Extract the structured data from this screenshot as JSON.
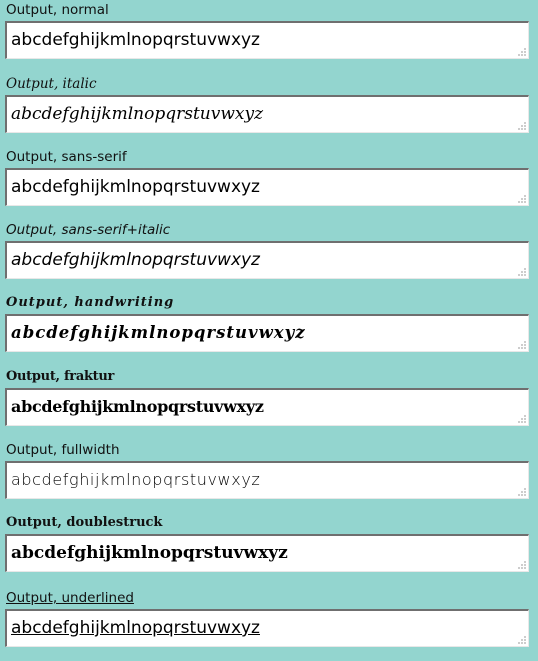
{
  "fields": [
    {
      "label": "Output, normal",
      "value": "abcdefghijkmlnopqrstuvwxyz"
    },
    {
      "label": "Output, italic",
      "value": "abcdefghijkmlnopqrstuvwxyz"
    },
    {
      "label": "Output, sans-serif",
      "value": "abcdefghijkmlnopqrstuvwxyz"
    },
    {
      "label": "Output, sans-serif+italic",
      "value": "abcdefghijkmlnopqrstuvwxyz"
    },
    {
      "label": "Output, handwriting",
      "value": "abcdefghijkmlnopqrstuvwxyz"
    },
    {
      "label": "Output, fraktur",
      "value": "abcdefghijkmlnopqrstuvwxyz"
    },
    {
      "label": "Output, fullwidth",
      "value": "abcdefghijkmlnopqrstuvwxyz"
    },
    {
      "label": "Output, doublestruck",
      "value": "abcdefghijkmlnopqrstuvwxyz"
    },
    {
      "label": "Output, underlined",
      "value": "abcdefghijkmlnopqrstuvwxyz"
    }
  ],
  "icons": {
    "resize": "resize-grip-icon"
  },
  "colors": {
    "background": "#93d5cf",
    "field": "#ffffff",
    "text": "#000000"
  }
}
